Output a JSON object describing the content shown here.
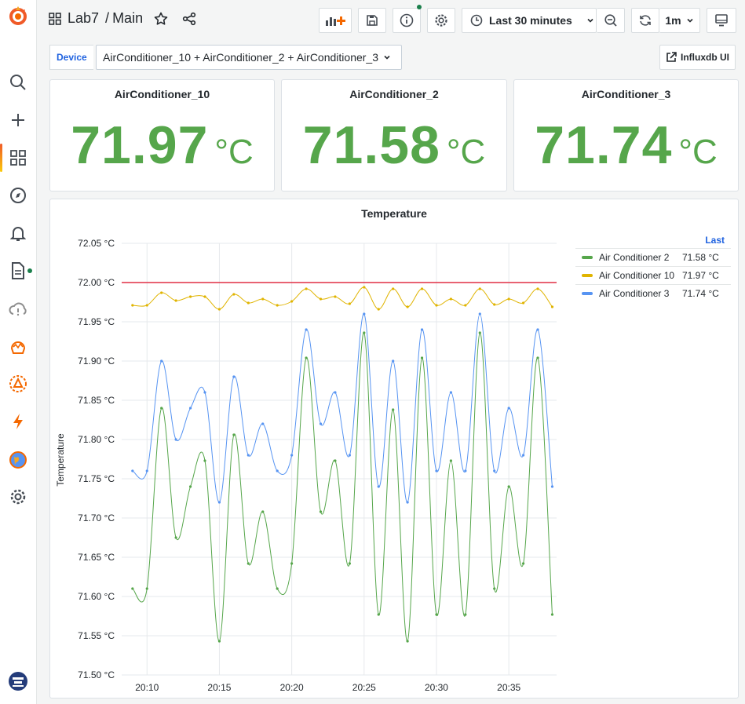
{
  "nav": {
    "folder": "Lab7",
    "separator": "/",
    "dashboard": "Main",
    "time_range": "Last 30 minutes",
    "refresh_interval": "1m"
  },
  "variables": {
    "label": "Device",
    "selected": "AirConditioner_10 + AirConditioner_2 + AirConditioner_3",
    "link_label": "Influxdb UI"
  },
  "stats": [
    {
      "title": "AirConditioner_10",
      "value": "71.97",
      "unit": "°C"
    },
    {
      "title": "AirConditioner_2",
      "value": "71.58",
      "unit": "°C"
    },
    {
      "title": "AirConditioner_3",
      "value": "71.74",
      "unit": "°C"
    }
  ],
  "colors": {
    "stat_value": "#56a64b",
    "accent": "#1f62e0",
    "threshold": "#e02f44"
  },
  "chart_data": {
    "type": "line",
    "title": "Temperature",
    "ylabel": "Temperature",
    "unit": "°C",
    "ylim": [
      71.5,
      72.05
    ],
    "yticks": [
      "72.05 °C",
      "72.00 °C",
      "71.95 °C",
      "71.90 °C",
      "71.85 °C",
      "71.80 °C",
      "71.75 °C",
      "71.70 °C",
      "71.65 °C",
      "71.60 °C",
      "71.55 °C",
      "71.50 °C"
    ],
    "xticks": [
      "20:10",
      "20:15",
      "20:20",
      "20:25",
      "20:30",
      "20:35"
    ],
    "x_minutes_range": [
      8.25,
      38.3
    ],
    "threshold": 72.0,
    "legend_header": "Last",
    "legend_position": "right",
    "x": [
      9,
      10,
      11,
      12,
      13,
      14,
      15,
      16,
      17,
      18,
      19,
      20,
      21,
      22,
      23,
      24,
      25,
      26,
      27,
      28,
      29,
      30,
      31,
      32,
      33,
      34,
      35,
      36,
      37,
      38
    ],
    "series": [
      {
        "name": "Air Conditioner 2",
        "last": "71.58 °C",
        "color": "#56a64b",
        "values": [
          71.61,
          71.61,
          71.84,
          71.675,
          71.74,
          71.773,
          71.543,
          71.806,
          71.642,
          71.708,
          71.61,
          71.642,
          71.904,
          71.708,
          71.773,
          71.642,
          71.936,
          71.577,
          71.838,
          71.543,
          71.904,
          71.577,
          71.773,
          71.577,
          71.936,
          71.61,
          71.74,
          71.642,
          71.904,
          71.577
        ]
      },
      {
        "name": "Air Conditioner 10",
        "last": "71.97 °C",
        "color": "#e0b400",
        "values": [
          71.971,
          71.971,
          71.987,
          71.977,
          71.982,
          71.982,
          71.966,
          71.985,
          71.974,
          71.979,
          71.971,
          71.976,
          71.992,
          71.979,
          71.982,
          71.973,
          71.994,
          71.966,
          71.992,
          71.969,
          71.992,
          71.971,
          71.979,
          71.971,
          71.992,
          71.972,
          71.979,
          71.974,
          71.992,
          71.969
        ]
      },
      {
        "name": "Air Conditioner 3",
        "last": "71.74 °C",
        "color": "#5794f2",
        "values": [
          71.76,
          71.76,
          71.9,
          71.8,
          71.84,
          71.86,
          71.72,
          71.88,
          71.78,
          71.82,
          71.76,
          71.78,
          71.94,
          71.82,
          71.86,
          71.78,
          71.96,
          71.74,
          71.9,
          71.72,
          71.94,
          71.76,
          71.86,
          71.76,
          71.96,
          71.76,
          71.84,
          71.78,
          71.94,
          71.74
        ]
      }
    ]
  }
}
